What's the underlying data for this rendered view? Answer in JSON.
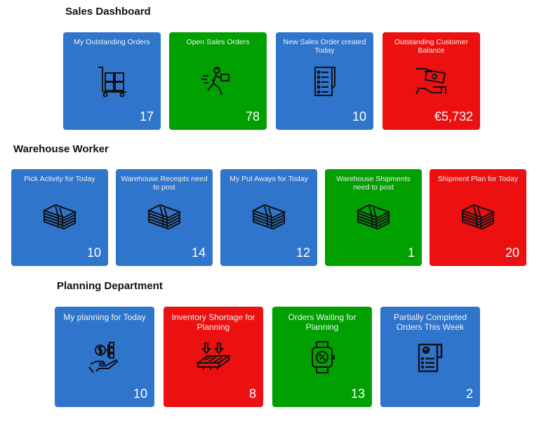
{
  "sections": [
    {
      "title": "Sales Dashboard",
      "tiles": [
        {
          "title": "My Outstanding Orders",
          "value": "17",
          "color": "#2f75cc",
          "icon": "hand-truck-icon"
        },
        {
          "title": "Open Sales  Orders",
          "value": "78",
          "color": "#00a000",
          "icon": "delivery-man-icon"
        },
        {
          "title": "New Sales Order created Today",
          "value": "10",
          "color": "#2f75cc",
          "icon": "order-list-icon"
        },
        {
          "title": "Outstanding Customer Balance",
          "value": "€5,732",
          "color": "#ec1010",
          "icon": "payment-hand-icon"
        }
      ]
    },
    {
      "title": "Warehouse Worker",
      "tiles": [
        {
          "title": "Pick Activity for Today",
          "value": "10",
          "color": "#2f75cc",
          "icon": "money-stack-icon"
        },
        {
          "title": "Warehouse Receipts need to post",
          "value": "14",
          "color": "#2f75cc",
          "icon": "money-stack-icon"
        },
        {
          "title": "My Put Aways for Today",
          "value": "12",
          "color": "#2f75cc",
          "icon": "money-stack-icon"
        },
        {
          "title": "Warehouse Shipments need to post",
          "value": "1",
          "color": "#00a000",
          "icon": "money-stack-icon"
        },
        {
          "title": "Shipment Plan for Today",
          "value": "20",
          "color": "#ec1010",
          "icon": "money-stack-icon"
        }
      ]
    },
    {
      "title": "Planning Department",
      "tiles": [
        {
          "title": "My planning for Today",
          "value": "10",
          "color": "#2f75cc",
          "icon": "dollar-plan-hand-icon"
        },
        {
          "title": "Inventory Shortage for Planning",
          "value": "8",
          "color": "#ec1010",
          "icon": "pallet-icon"
        },
        {
          "title": "Orders Waiting for Planning",
          "value": "13",
          "color": "#00a000",
          "icon": "smartwatch-discount-icon"
        },
        {
          "title": "Partially Completed Orders This Week",
          "value": "2",
          "color": "#2f75cc",
          "icon": "receipt-check-icon"
        }
      ]
    }
  ]
}
